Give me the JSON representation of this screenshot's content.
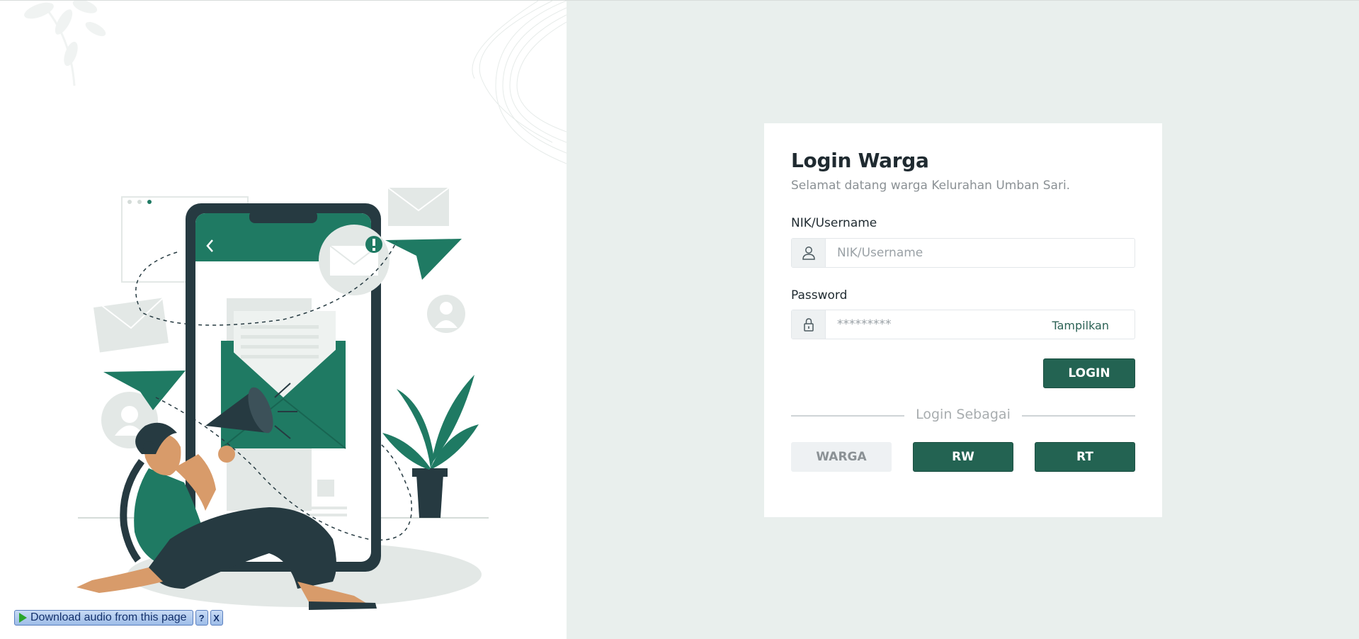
{
  "login": {
    "title": "Login Warga",
    "subtitle": "Selamat datang warga Kelurahan Umban Sari.",
    "username_label": "NIK/Username",
    "username_placeholder": "NIK/Username",
    "password_label": "Password",
    "password_placeholder": "*********",
    "show_password_label": "Tampilkan",
    "login_button": "LOGIN",
    "login_as_label": "Login Sebagai",
    "roles": [
      {
        "label": "WARGA",
        "state": "inactive"
      },
      {
        "label": "RW",
        "state": "active"
      },
      {
        "label": "RT",
        "state": "active"
      }
    ]
  },
  "audio_toolbar": {
    "download_label": "Download audio from this page",
    "help_label": "?",
    "close_label": "X"
  },
  "colors": {
    "accent": "#236352",
    "background_right": "#e9efed",
    "illustration_green": "#1f7a63"
  },
  "icons": [
    "user-icon",
    "lock-icon",
    "play-icon"
  ]
}
